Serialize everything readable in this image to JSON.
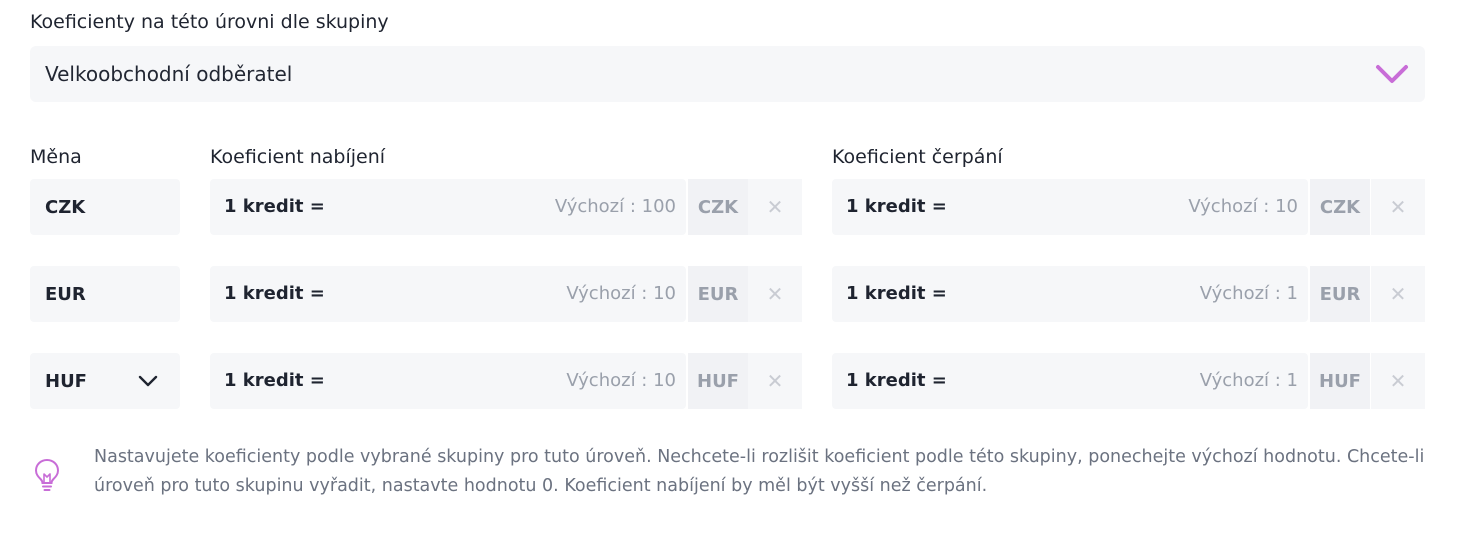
{
  "group": {
    "label": "Koeficienty na této úrovni dle skupiny",
    "selected": "Velkoobchodní odběratel",
    "accent_color": "#c86dd7"
  },
  "columns": {
    "currency": "Měna",
    "charge": "Koeficient nabíjení",
    "draw": "Koeficient čerpání"
  },
  "rows": [
    {
      "currency": "CZK",
      "charge": {
        "label": "1 kredit =",
        "default": "Výchozí : 100",
        "unit": "CZK"
      },
      "draw": {
        "label": "1 kredit =",
        "default": "Výchozí : 10",
        "unit": "CZK"
      }
    },
    {
      "currency": "EUR",
      "charge": {
        "label": "1 kredit =",
        "default": "Výchozí : 10",
        "unit": "EUR"
      },
      "draw": {
        "label": "1 kredit =",
        "default": "Výchozí : 1",
        "unit": "EUR"
      }
    },
    {
      "currency": "HUF",
      "charge": {
        "label": "1 kredit =",
        "default": "Výchozí : 10",
        "unit": "HUF"
      },
      "draw": {
        "label": "1 kredit =",
        "default": "Výchozí : 1",
        "unit": "HUF"
      }
    }
  ],
  "hint": {
    "icon": "lightbulb-icon",
    "text": "Nastavujete koeficienty podle vybrané skupiny pro tuto úroveň. Nechcete-li rozlišit koeficient podle této skupiny, ponechejte výchozí hodnotu. Chcete-li úroveň pro tuto skupinu vyřadit, nastavte hodnotu 0. Koeficient nabíjení by měl být vyšší než čerpání."
  }
}
